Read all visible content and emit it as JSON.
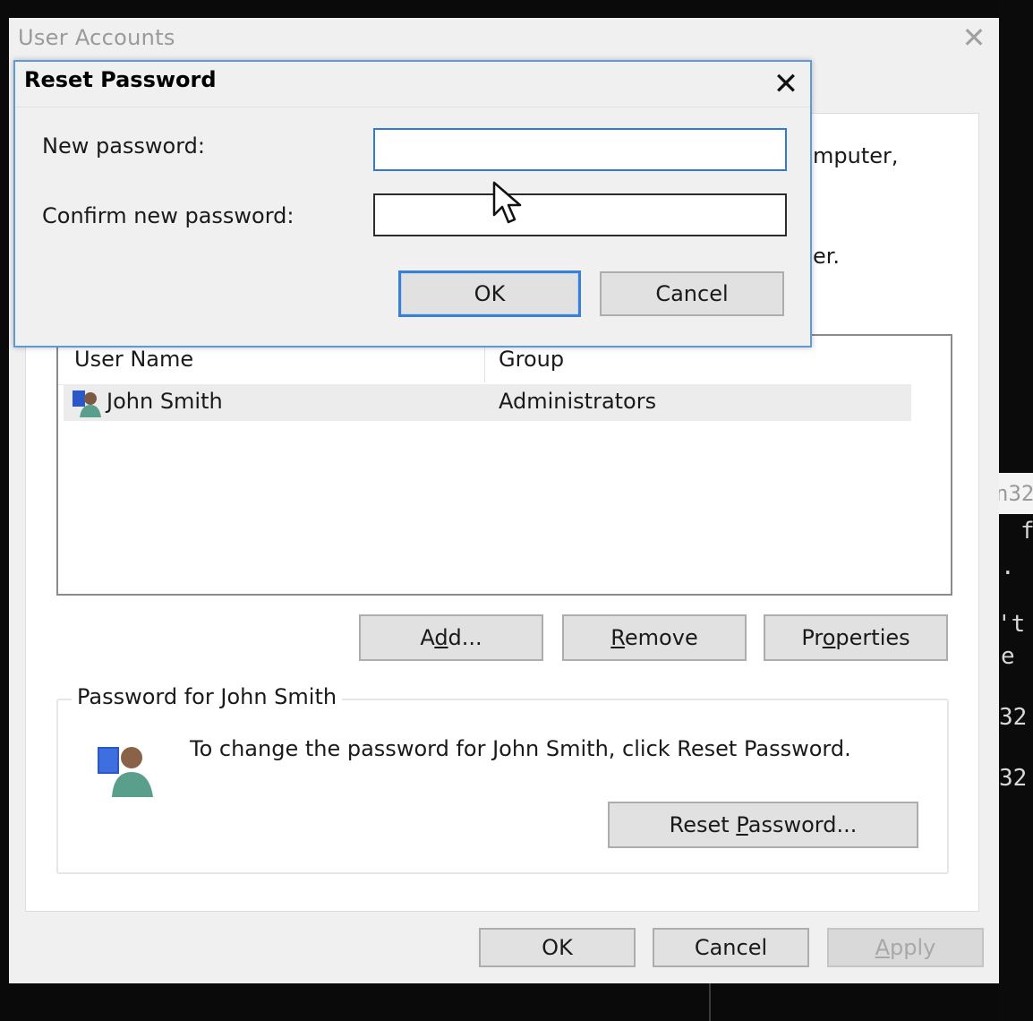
{
  "terminal": {
    "tab_fragment": "n32",
    "lines": [
      "f",
      ".",
      "'t",
      "e",
      "32",
      "32"
    ]
  },
  "user_accounts": {
    "title": "User Accounts",
    "background_text_1": "mputer,",
    "background_text_2": "er.",
    "columns": [
      "User Name",
      "Group"
    ],
    "users": [
      {
        "name": "John Smith",
        "group": "Administrators"
      }
    ],
    "buttons": {
      "add": {
        "pre": "A",
        "acc": "d",
        "post": "d..."
      },
      "remove": {
        "pre": "",
        "acc": "R",
        "post": "emove"
      },
      "properties": {
        "pre": "Pr",
        "acc": "o",
        "post": "perties"
      }
    },
    "password_group": {
      "legend": "Password for John Smith",
      "text": "To change the password for John Smith, click Reset Password.",
      "reset_button": {
        "pre": "Reset ",
        "acc": "P",
        "post": "assword..."
      }
    },
    "footer": {
      "ok": "OK",
      "cancel": "Cancel",
      "apply": {
        "pre": "",
        "acc": "A",
        "post": "pply"
      }
    }
  },
  "reset_password_dialog": {
    "title": "Reset Password",
    "new_password_label": "New password:",
    "new_password_value": "",
    "confirm_label": "Confirm new password:",
    "confirm_value": "",
    "ok": "OK",
    "cancel": "Cancel"
  },
  "colors": {
    "focus_border": "#2f7bd2",
    "dialog_border": "#5e9ad6",
    "window_bg": "#f0f0f0"
  }
}
